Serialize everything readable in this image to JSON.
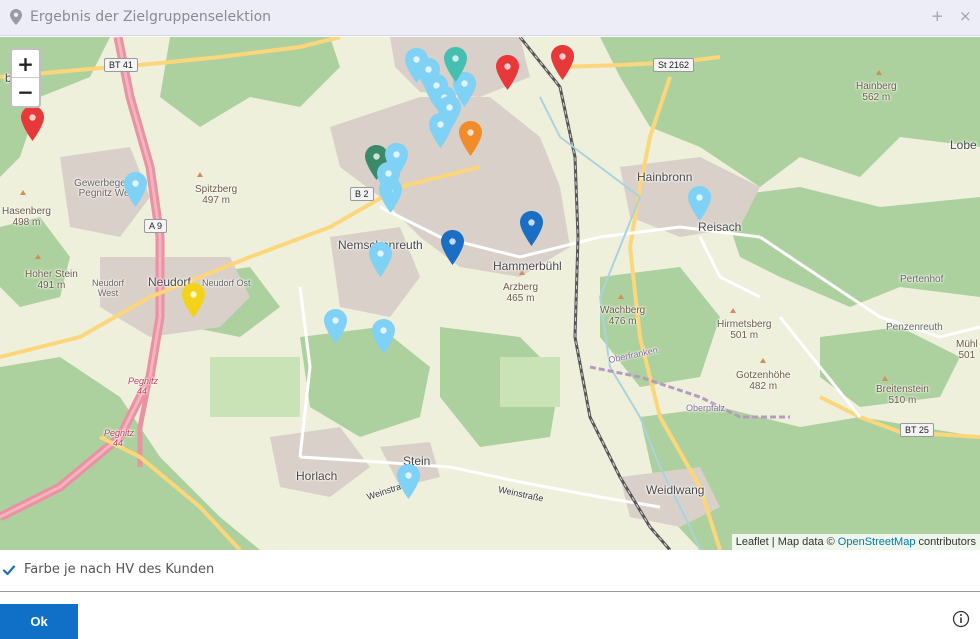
{
  "dialog": {
    "title": "Ergebnis der Zielgruppenselektion",
    "icons": {
      "title": "map-marker-icon",
      "add": "plus-icon",
      "close": "close-icon",
      "info": "info-icon"
    },
    "add_glyph": "+",
    "close_glyph": "×"
  },
  "map": {
    "zoom_in": "+",
    "zoom_out": "−",
    "attribution_prefix": "Leaflet | Map data ©",
    "attribution_link": "OpenStreetMap",
    "attribution_suffix": "contributors",
    "labels": {
      "nemschenreuth": "Nemschenreuth",
      "hammerbuehl": "Hammerbühl",
      "hainbronn": "Hainbronn",
      "reisach": "Reisach",
      "neudorf": "Neudorf",
      "neudorf_ost": "Neudorf Ost",
      "neudorf_west": "Neudorf West",
      "horlach": "Horlach",
      "stein": "Stein",
      "weidlwang": "Weidlwang",
      "pertenhof": "Pertenhof",
      "penzenreuth": "Penzenreuth",
      "lobe": "Lobe",
      "muehl": "Mühl",
      "muehl_ele": "501",
      "berg": "berg",
      "gewerbegebiet": "Gewerbegebiet Pegnitz West",
      "hainberg": "Hainberg",
      "hainberg_ele": "562 m",
      "spitzberg": "Spitzberg",
      "spitzberg_ele": "497 m",
      "hasenberg": "Hasenberg",
      "hasenberg_ele": "498 m",
      "hoher_stein": "Hoher Stein",
      "hoher_stein_ele": "491 m",
      "arzberg": "Arzberg",
      "arzberg_ele": "465 m",
      "wachberg": "Wachberg",
      "wachberg_ele": "476 m",
      "hirmetsberg": "Hirmetsberg",
      "hirmetsberg_ele": "501 m",
      "gotzenhoehe": "Gotzenhöhe",
      "gotzenhoehe_ele": "482 m",
      "breitenstein": "Breitenstein",
      "breitenstein_ele": "510 m",
      "oberfranken": "Oberfranken",
      "oberpfalz": "Oberpfalz",
      "weinstrasse_1": "Weinstraße",
      "weinstrasse_2": "Weinstraße",
      "pegnitz_44a": "Pegnitz 44",
      "pegnitz_44b": "Pegnitz 44"
    },
    "shields": {
      "bt41": "BT 41",
      "st2162": "St 2162",
      "b2": "B 2",
      "a9": "A 9",
      "bt25": "BT 25"
    },
    "colors": {
      "light_blue": "#7fd1f5",
      "teal": "#45bfb0",
      "dark_green": "#3a8a6a",
      "red": "#e8393a",
      "orange": "#f28c28",
      "dark_blue": "#1a6fc4",
      "yellow": "#f3d21a"
    }
  },
  "options": {
    "color_by_hv_label": "Farbe je nach HV des Kunden",
    "color_by_hv_checked": true
  },
  "footer": {
    "ok_label": "Ok"
  }
}
